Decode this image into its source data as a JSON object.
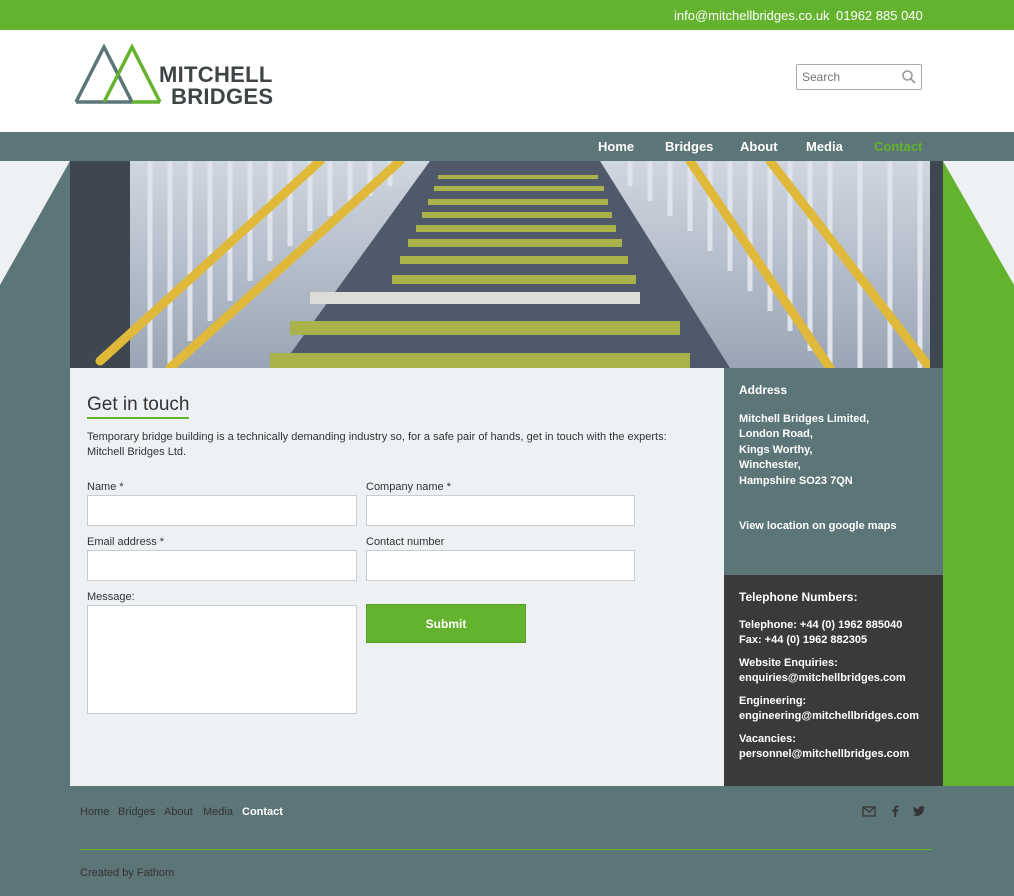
{
  "topbar": {
    "email": "info@mitchellbridges.co.uk",
    "phone": "01962 885 040"
  },
  "logo": {
    "line1": "MITCHELL",
    "line2": "BRIDGES",
    "colors": {
      "green": "#64b32e",
      "slate": "#5c7578"
    }
  },
  "search": {
    "placeholder": "Search"
  },
  "nav": {
    "items": [
      {
        "label": "Home"
      },
      {
        "label": "Bridges"
      },
      {
        "label": "About"
      },
      {
        "label": "Media"
      },
      {
        "label": "Contact",
        "active": true
      }
    ]
  },
  "main": {
    "title": "Get in touch",
    "intro": "Temporary bridge building is a technically demanding industry so, for a safe pair of hands, get in touch with the experts: Mitchell Bridges Ltd.",
    "form": {
      "name_label": "Name *",
      "company_label": "Company name *",
      "email_label": "Email address *",
      "contact_label": "Contact number",
      "message_label": "Message:",
      "submit_label": "Submit"
    }
  },
  "address": {
    "title": "Address",
    "lines": [
      "Mitchell Bridges Limited,",
      "London Road,",
      "Kings Worthy,",
      "Winchester,",
      "Hampshire SO23 7QN"
    ],
    "map_link": "View location on google maps"
  },
  "phones": {
    "title": "Telephone Numbers:",
    "telephone": "Telephone: +44 (0) 1962 885040",
    "fax": "Fax: +44 (0) 1962 882305",
    "web_label": "Website Enquiries:",
    "web_email": "enquiries@mitchellbridges.com",
    "eng_label": "Engineering:",
    "eng_email": "engineering@mitchellbridges.com",
    "vac_label": "Vacancies:",
    "vac_email": "personnel@mitchellbridges.com"
  },
  "footer": {
    "links": [
      {
        "label": "Home"
      },
      {
        "label": "Bridges"
      },
      {
        "label": "About"
      },
      {
        "label": "Media"
      },
      {
        "label": "Contact",
        "active": true
      }
    ],
    "social_icons": [
      "mail-icon",
      "facebook-icon",
      "twitter-icon"
    ],
    "credit": "Created by Fathom"
  },
  "colors": {
    "accent": "#64b32e",
    "slate": "#5c7578",
    "dark": "#3a3a3a",
    "light": "#eef1f4"
  }
}
